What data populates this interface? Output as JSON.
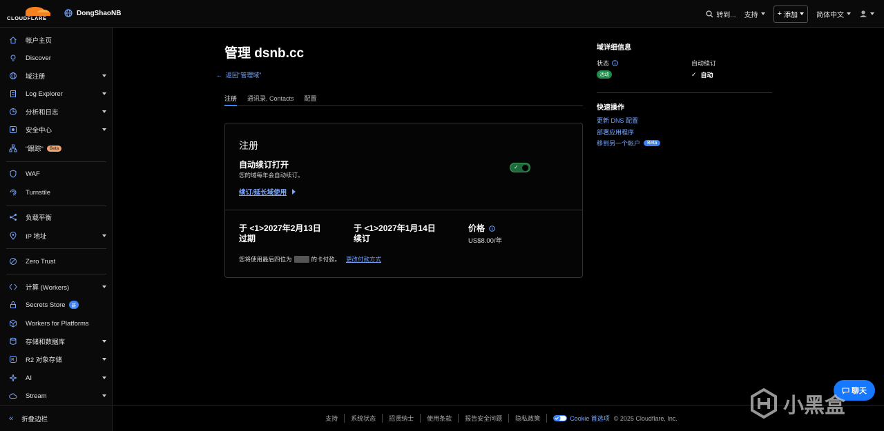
{
  "topbar": {
    "brand": "CLOUDFLARE",
    "account_name": "DongShaoNB",
    "goto_label": "转到...",
    "support_label": "支持",
    "add_label": "添加",
    "language_label": "简体中文"
  },
  "sidebar": {
    "items": [
      {
        "label": "帐户主页",
        "icon": "home-icon"
      },
      {
        "label": "Discover",
        "icon": "lightbulb-icon"
      },
      {
        "label": "域注册",
        "icon": "globe-icon"
      },
      {
        "label": "Log Explorer",
        "icon": "document-icon"
      },
      {
        "label": "分析和日志",
        "icon": "chart-icon"
      },
      {
        "label": "安全中心",
        "icon": "security-icon"
      },
      {
        "label": "\"跟踪\"",
        "icon": "trace-icon",
        "badge": "Beta"
      },
      {
        "label": "WAF",
        "icon": "shield-icon"
      },
      {
        "label": "Turnstile",
        "icon": "turnstile-icon"
      },
      {
        "label": "负载平衡",
        "icon": "load-balancer-icon"
      },
      {
        "label": "IP 地址",
        "icon": "location-icon"
      },
      {
        "label": "Zero Trust",
        "icon": "zero-trust-icon"
      },
      {
        "label": "计算 (Workers)",
        "icon": "workers-icon"
      },
      {
        "label": "Secrets Store",
        "icon": "lock-icon",
        "badge": "新"
      },
      {
        "label": "Workers for Platforms",
        "icon": "cube-icon"
      },
      {
        "label": "存储和数据库",
        "icon": "database-icon"
      },
      {
        "label": "R2 对象存储",
        "icon": "r2-icon"
      },
      {
        "label": "AI",
        "icon": "sparkle-icon"
      },
      {
        "label": "Stream",
        "icon": "cloud-icon"
      }
    ],
    "collapse_label": "折叠边栏"
  },
  "main": {
    "title": "管理 dsnb.cc",
    "back_label": "返回\"管理域\"",
    "tabs": [
      "注册",
      "通讯录, Contacts",
      "配置"
    ],
    "card": {
      "title": "注册",
      "auto_renew_title": "自动续订打开",
      "auto_renew_sub": "您的域每年会自动续订。",
      "renew_link": "续订/延长域使用",
      "expire_line1": "于 <1>2027年2月13日",
      "expire_line2": "过期",
      "renew_line1": "于 <1>2027年1月14日",
      "renew_line2": "续订",
      "price_label": "价格",
      "price_value": "US$8.00/年",
      "pay_prefix": "您将使用最后四位为",
      "pay_suffix": "的卡付款。",
      "pay_link": "更改付款方式"
    }
  },
  "details": {
    "title": "域详细信息",
    "status_label": "状态",
    "status_value": "活动",
    "auto_label": "自动续订",
    "auto_value": "自动",
    "quick_title": "快速操作",
    "quick_links": [
      "更新 DNS 配置",
      "部署应用程序",
      "移到另一个帐户"
    ],
    "quick_badge": "Beta"
  },
  "footer": {
    "links": [
      "支持",
      "系统状态",
      "招贤纳士",
      "使用条款",
      "报告安全问题",
      "隐私政策"
    ],
    "cookie_label": "Cookie 首选项",
    "copyright": "© 2025 Cloudflare, Inc."
  },
  "chat_label": "聊天",
  "watermark": "小黑盒",
  "colors": {
    "accent": "#3b82f6",
    "link": "#78a6ff",
    "success": "#1f8a4a",
    "brand_orange": "#f6821f"
  }
}
